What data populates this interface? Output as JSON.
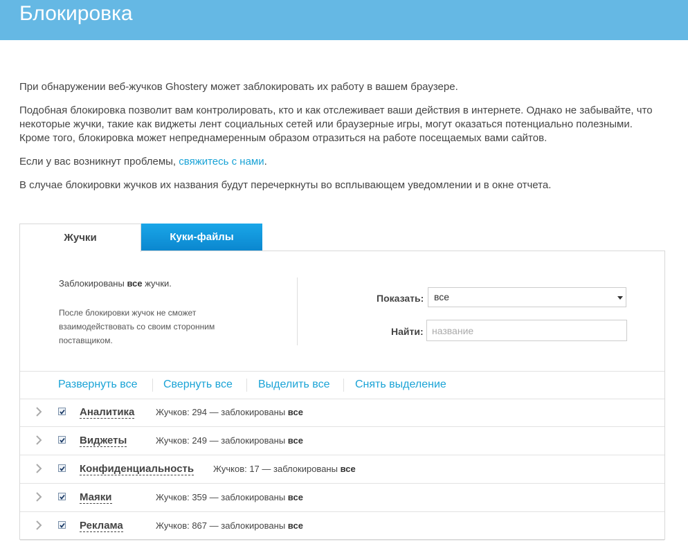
{
  "header": {
    "title": "Блокировка"
  },
  "intro": {
    "p1": "При обнаружении веб-жучков Ghostery может заблокировать их работу в вашем браузере.",
    "p2": "Подобная блокировка позволит вам контролировать, кто и как отслеживает ваши действия в интернете. Однако не забывайте, что некоторые жучки, такие как виджеты лент социальных сетей или браузерные игры, могут оказаться потенциально полезными. Кроме того, блокировка может непреднамеренным образом отразиться на работе посещаемых вами сайтов.",
    "p3_prefix": "Если у вас возникнут проблемы, ",
    "p3_link": "свяжитесь с нами",
    "p3_suffix": ".",
    "p4": "В случае блокировки жучков их названия будут перечеркнуты во всплывающем уведомлении и в окне отчета."
  },
  "tabs": {
    "bugs": "Жучки",
    "cookies": "Куки-файлы"
  },
  "status": {
    "prefix": "Заблокированы ",
    "bold": "все",
    "suffix": " жучки.",
    "note": "После блокировки жучок не сможет взаимодействовать со своим сторонним поставщиком."
  },
  "filter": {
    "show_label": "Показать:",
    "show_value": "все",
    "find_label": "Найти:",
    "find_placeholder": "название",
    "find_value": ""
  },
  "actions": {
    "expand": "Развернуть все",
    "collapse": "Свернуть все",
    "select": "Выделить все",
    "deselect": "Снять выделение"
  },
  "categories": [
    {
      "name": "Аналитика",
      "info": "Жучков: 294 — заблокированы ",
      "bold": "все",
      "checked": true
    },
    {
      "name": "Виджеты",
      "info": "Жучков: 249 — заблокированы ",
      "bold": "все",
      "checked": true
    },
    {
      "name": "Конфиденциальность",
      "info": "Жучков: 17 — заблокированы ",
      "bold": "все",
      "checked": true
    },
    {
      "name": "Маяки",
      "info": "Жучков: 359 — заблокированы ",
      "bold": "все",
      "checked": true
    },
    {
      "name": "Реклама",
      "info": "Жучков: 867 — заблокированы ",
      "bold": "все",
      "checked": true
    }
  ],
  "colors": {
    "header_bg": "#65b8e4",
    "link": "#1aa3d6",
    "tab_active_bg": "#0b87cf"
  }
}
